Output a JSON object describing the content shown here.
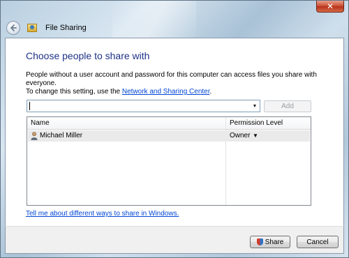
{
  "window": {
    "title": "File Sharing",
    "close_glyph": "✕"
  },
  "main": {
    "heading": "Choose people to share with",
    "description_line1": "People without a user account and password for this computer can access files you share with everyone.",
    "description_line2_prefix": "To change this setting, use the ",
    "description_link": "Network and Sharing Center",
    "description_line2_suffix": "."
  },
  "picker": {
    "input_value": "",
    "add_label": "Add"
  },
  "grid": {
    "columns": [
      "Name",
      "Permission Level"
    ],
    "rows": [
      {
        "name": "Michael Miller",
        "permission": "Owner"
      }
    ]
  },
  "help_link": "Tell me about different ways to share in Windows.",
  "footer": {
    "share_label": "Share",
    "cancel_label": "Cancel"
  },
  "icons": {
    "back": "back-arrow-icon",
    "app": "file-sharing-icon",
    "user": "user-icon",
    "shield": "uac-shield-icon"
  },
  "colors": {
    "heading": "#1e3287",
    "link": "#0046d5",
    "row_highlight": "#eaeaea"
  }
}
